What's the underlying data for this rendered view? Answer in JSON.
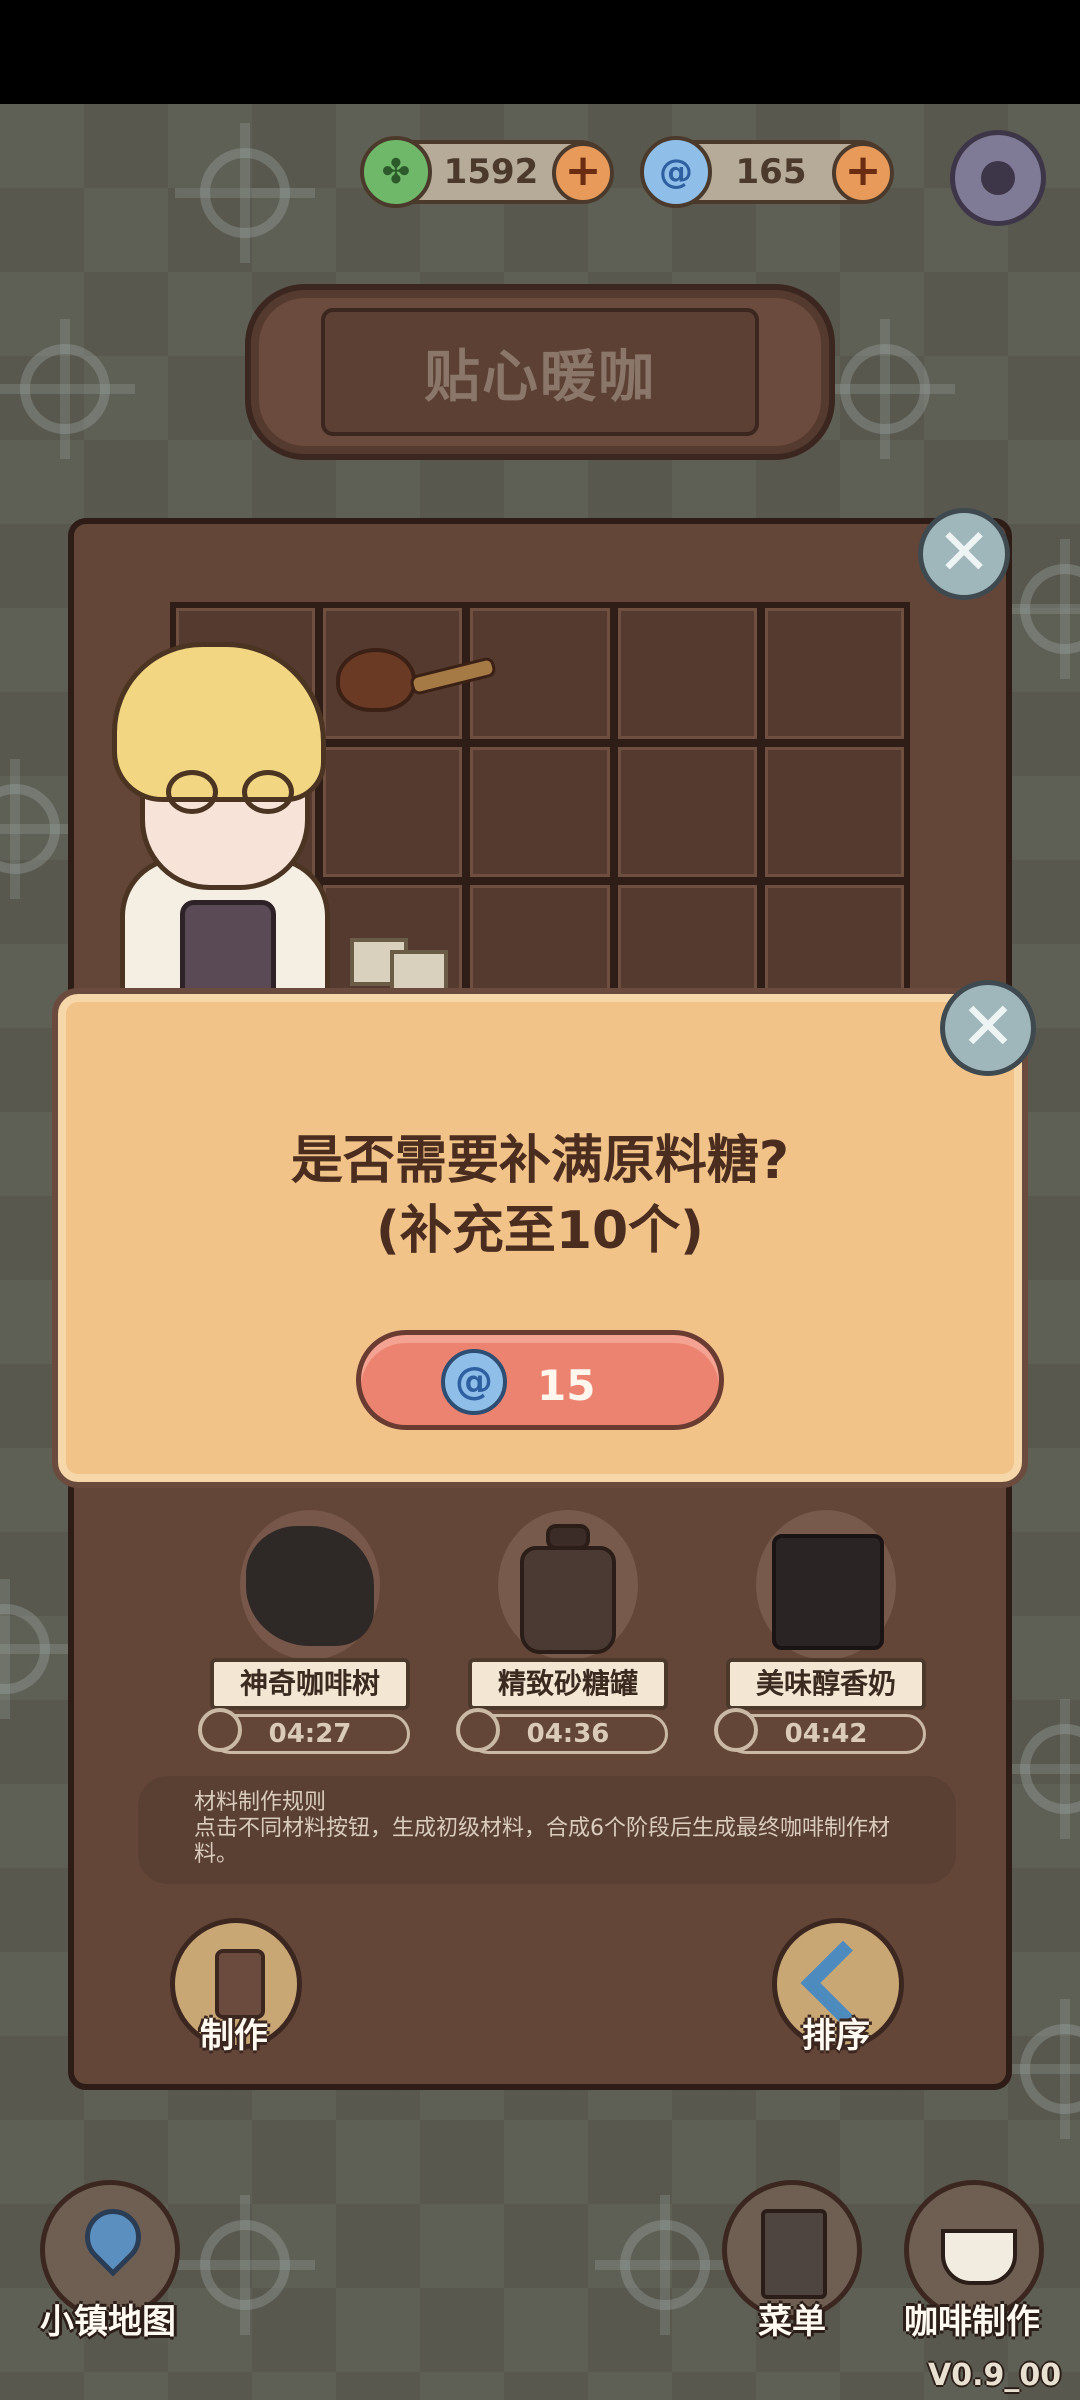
{
  "currencies": [
    {
      "icon": "leaf-coin-icon",
      "value": "1592",
      "color": "#6fb86a"
    },
    {
      "icon": "swirl-gem-icon",
      "value": "165",
      "color": "#8fbfe8"
    }
  ],
  "title": "贴心暖咖",
  "dialog": {
    "question_line1": "是否需要补满原料糖?",
    "question_line2": "(补充至10个)",
    "cost": "15",
    "cost_icon": "swirl-gem-icon"
  },
  "stations": [
    {
      "name": "神奇咖啡树",
      "timer": "04:27"
    },
    {
      "name": "精致砂糖罐",
      "timer": "04:36"
    },
    {
      "name": "美味醇香奶",
      "timer": "04:42"
    }
  ],
  "rules": {
    "title": "材料制作规则",
    "body": "点击不同材料按钮，生成初级材料，合成6个阶段后生成最终咖啡制作材料。"
  },
  "actions": {
    "craft": "制作",
    "sort": "排序"
  },
  "nav": {
    "map": "小镇地图",
    "menu": "菜单",
    "coffee": "咖啡制作"
  },
  "version": "V0.9_00",
  "colors": {
    "dialog_bg": "#f2c389",
    "buy_button": "#ec8370",
    "panel": "#644638"
  }
}
